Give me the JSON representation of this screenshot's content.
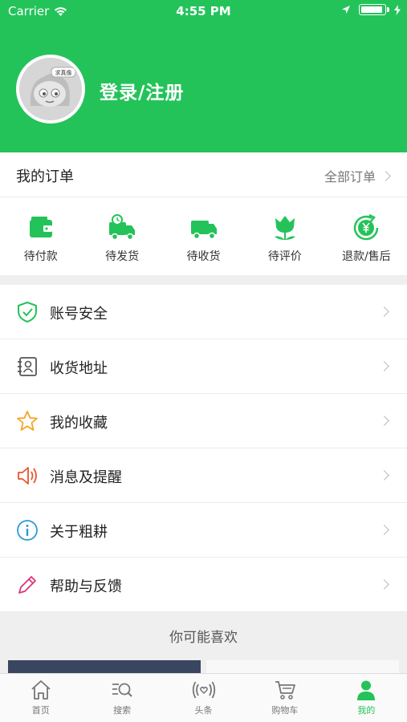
{
  "status_bar": {
    "carrier": "Carrier",
    "time": "4:55 PM"
  },
  "profile": {
    "avatar_badge": "求真像",
    "login_text": "登录/注册"
  },
  "orders": {
    "title": "我的订单",
    "all_orders": "全部订单",
    "items": [
      {
        "label": "待付款",
        "icon": "wallet-icon"
      },
      {
        "label": "待发货",
        "icon": "delivery-truck-icon"
      },
      {
        "label": "待收货",
        "icon": "truck-icon"
      },
      {
        "label": "待评价",
        "icon": "tulip-icon"
      },
      {
        "label": "退款/售后",
        "icon": "refund-yen-icon"
      }
    ]
  },
  "menu": [
    {
      "label": "账号安全",
      "icon": "shield-icon",
      "color": "#24c35a"
    },
    {
      "label": "收货地址",
      "icon": "address-book-icon",
      "color": "#555555"
    },
    {
      "label": "我的收藏",
      "icon": "star-icon",
      "color": "#f5a623"
    },
    {
      "label": "消息及提醒",
      "icon": "speaker-icon",
      "color": "#e8542f"
    },
    {
      "label": "关于粗耕",
      "icon": "info-icon",
      "color": "#2a9bd8"
    },
    {
      "label": "帮助与反馈",
      "icon": "pencil-icon",
      "color": "#d8377a"
    }
  ],
  "recommend": {
    "title": "你可能喜欢"
  },
  "tabbar": [
    {
      "label": "首页",
      "icon": "home-icon"
    },
    {
      "label": "搜索",
      "icon": "search-list-icon"
    },
    {
      "label": "头条",
      "icon": "broadcast-heart-icon"
    },
    {
      "label": "购物车",
      "icon": "cart-icon"
    },
    {
      "label": "我的",
      "icon": "person-icon",
      "active": true
    }
  ],
  "colors": {
    "accent": "#24c35a",
    "background_gray": "#efefef"
  }
}
